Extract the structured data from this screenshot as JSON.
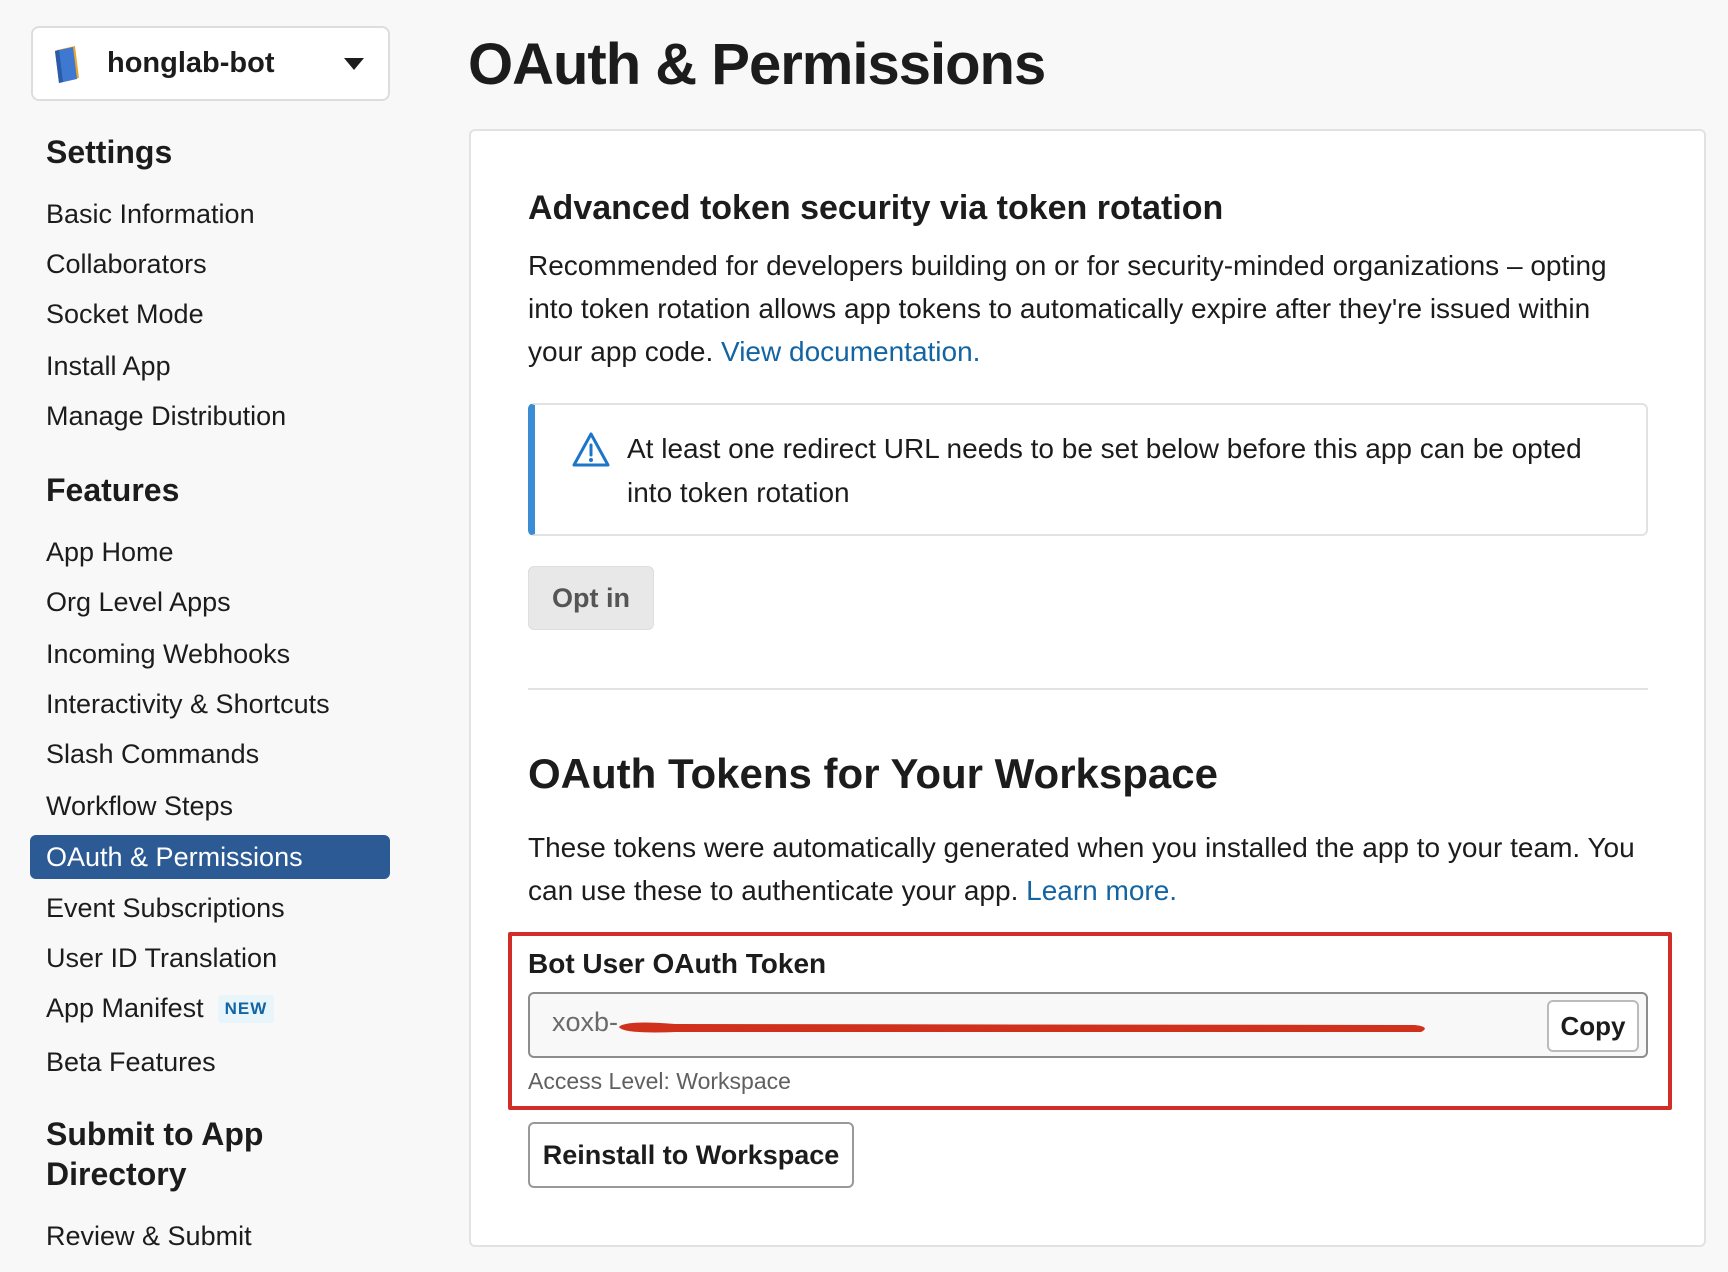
{
  "app_switcher": {
    "name": "honglab-bot",
    "icon": "blue-book-app-icon"
  },
  "sidebar": {
    "settings_heading": "Settings",
    "settings_items": [
      "Basic Information",
      "Collaborators",
      "Socket Mode",
      "Install App",
      "Manage Distribution"
    ],
    "features_heading": "Features",
    "features_items": [
      "App Home",
      "Org Level Apps",
      "Incoming Webhooks",
      "Interactivity & Shortcuts",
      "Slash Commands",
      "Workflow Steps",
      "OAuth & Permissions",
      "Event Subscriptions",
      "User ID Translation",
      "App Manifest",
      "Beta Features"
    ],
    "app_manifest_badge": "NEW",
    "active_item": "OAuth & Permissions",
    "submit_heading_line1": "Submit to App",
    "submit_heading_line2": "Directory",
    "submit_items": [
      "Review & Submit"
    ]
  },
  "page": {
    "title": "OAuth & Permissions"
  },
  "token_rotation": {
    "heading": "Advanced token security via token rotation",
    "description": "Recommended for developers building on or for security-minded organizations – opting into token rotation allows app tokens to automatically expire after they're issued within your app code.",
    "doc_link": "View documentation.",
    "notice": "At least one redirect URL needs to be set below before this app can be opted into token rotation",
    "optin_button": "Opt in"
  },
  "oauth_tokens": {
    "heading": "OAuth Tokens for Your Workspace",
    "description": "These tokens were automatically generated when you installed the app to your team. You can use these to authenticate your app.",
    "learn_more": "Learn more.",
    "bot_token_label": "Bot User OAuth Token",
    "bot_token_value": "xoxb-",
    "copy_button": "Copy",
    "access_level": "Access Level: Workspace",
    "reinstall_button": "Reinstall to Workspace"
  },
  "colors": {
    "active_nav": "#2c5a94",
    "link": "#1264a3",
    "highlight_box": "#d02e26",
    "notice_accent": "#3a8cd4"
  }
}
